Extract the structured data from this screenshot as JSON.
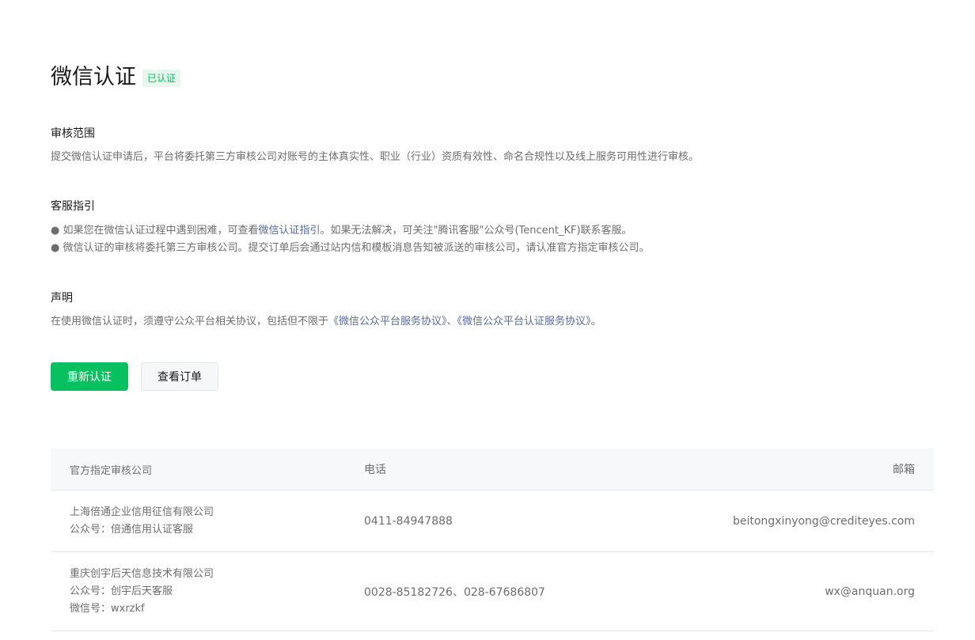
{
  "header": {
    "title": "微信认证",
    "badge": "已认证"
  },
  "sections": {
    "scope": {
      "title": "审核范围",
      "body": "提交微信认证申请后，平台将委托第三方审核公司对账号的主体真实性、职业（行业）资质有效性、命名合规性以及线上服务可用性进行审核。"
    },
    "guide": {
      "title": "客服指引",
      "line1_prefix": "● 如果您在微信认证过程中遇到困难，可查看",
      "line1_link": "微信认证指引",
      "line1_suffix": "。如果无法解决，可关注\"腾讯客服\"公众号(Tencent_KF)联系客服。",
      "line2": "● 微信认证的审核将委托第三方审核公司。提交订单后会通过站内信和模板消息告知被派送的审核公司，请认准官方指定审核公司。"
    },
    "statement": {
      "title": "声明",
      "prefix": "在使用微信认证时，须遵守公众平台相关协议，包括但不限于",
      "link1": "《微信公众平台服务协议》",
      "sep": "、",
      "link2": "《微信公众平台认证服务协议》",
      "suffix": "。"
    }
  },
  "buttons": {
    "recertify": "重新认证",
    "view_orders": "查看订单"
  },
  "table": {
    "headers": {
      "company": "官方指定审核公司",
      "phone": "电话",
      "email": "邮箱"
    },
    "rows": [
      {
        "company": "上海倍通企业信用征信有限公司",
        "account": "公众号：倍通信用认证客服",
        "phone": "0411-84947888",
        "email": "beitongxinyong@crediteyes.com"
      },
      {
        "company": "重庆创宇后天信息技术有限公司",
        "account": "公众号：创宇后天客服",
        "wechat": "微信号：wxrzkf",
        "phone": "0028-85182726、028-67686807",
        "email": "wx@anquan.org"
      }
    ]
  },
  "colors": {
    "accent": "#07c160",
    "link": "#576b95"
  }
}
